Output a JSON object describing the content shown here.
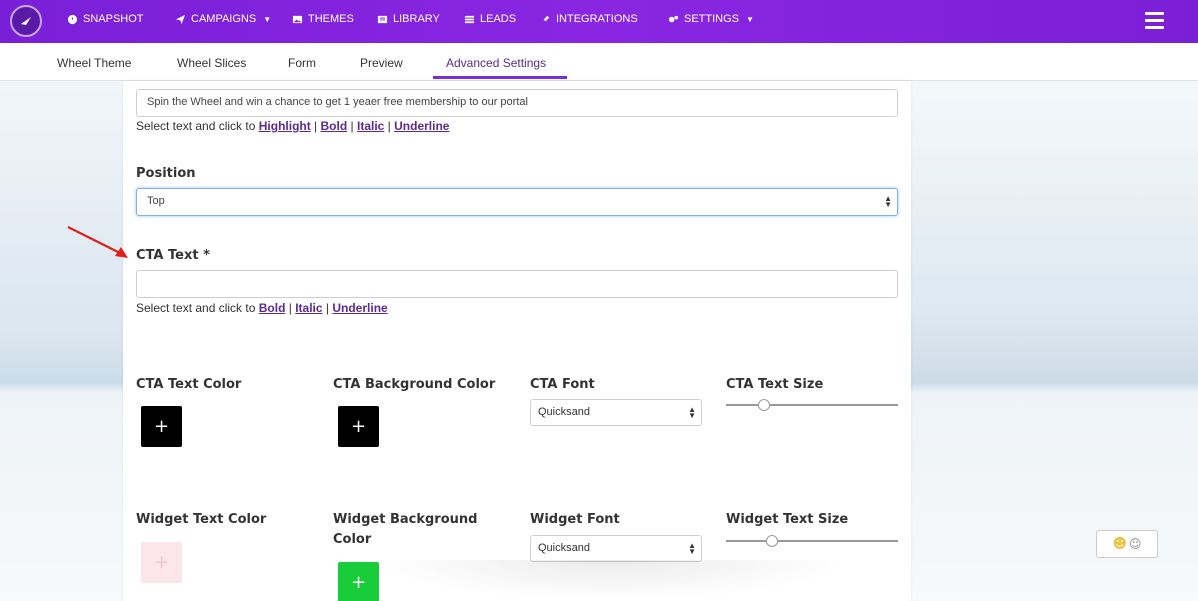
{
  "nav": {
    "items": [
      {
        "label": "SNAPSHOT",
        "icon": "dashboard-icon"
      },
      {
        "label": "CAMPAIGNS",
        "icon": "paper-plane-icon",
        "dropdown": true
      },
      {
        "label": "THEMES",
        "icon": "image-icon"
      },
      {
        "label": "LIBRARY",
        "icon": "book-icon"
      },
      {
        "label": "LEADS",
        "icon": "list-icon"
      },
      {
        "label": "INTEGRATIONS",
        "icon": "plug-icon"
      },
      {
        "label": "SETTINGS",
        "icon": "gears-icon",
        "dropdown": true
      }
    ],
    "menu_icon": "hamburger-icon"
  },
  "tabs": [
    {
      "label": "Wheel Theme"
    },
    {
      "label": "Wheel Slices"
    },
    {
      "label": "Form"
    },
    {
      "label": "Preview"
    },
    {
      "label": "Advanced Settings",
      "active": true
    }
  ],
  "form": {
    "title_value": "Spin the Wheel and win a chance to get 1 yeaer free membership to our portal",
    "title_helper_prefix": "Select text and click to",
    "title_helper_links": [
      "Highlight",
      "Bold",
      "Italic",
      "Underline"
    ],
    "position_label": "Position",
    "position_value": "Top",
    "cta_label": "CTA Text *",
    "cta_value": "",
    "cta_helper_prefix": "Select text and click to",
    "cta_helper_links": [
      "Bold",
      "Italic",
      "Underline"
    ],
    "cta_text_color_label": "CTA Text Color",
    "cta_bg_color_label": "CTA Background Color",
    "cta_font_label": "CTA Font",
    "cta_font_value": "Quicksand",
    "cta_text_size_label": "CTA Text Size",
    "cta_text_size_level": 0.22,
    "widget_text_color_label": "Widget Text Color",
    "widget_bg_color_label_1": "Widget Background",
    "widget_bg_color_label_2": "Color",
    "widget_font_label": "Widget Font",
    "widget_font_value": "Quicksand",
    "widget_text_size_label": "Widget Text Size",
    "widget_text_size_level": 0.27,
    "swatch_symbol": "+"
  },
  "colors": {
    "nav_bg": "#7a1fd8",
    "accent": "#5b2b8f",
    "cta_text_color": "#000000",
    "cta_bg_color": "#000000",
    "widget_text_color": "#f9e3e7",
    "widget_bg_color": "#19cc3a",
    "annotation_arrow": "#e0201b"
  }
}
